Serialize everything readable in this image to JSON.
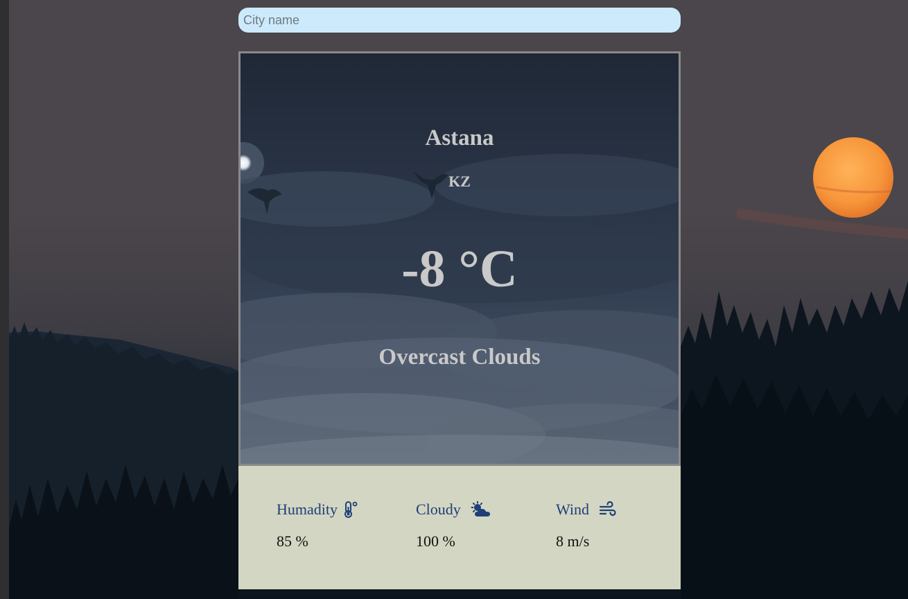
{
  "search": {
    "placeholder": "City name",
    "value": ""
  },
  "weather": {
    "city": "Astana",
    "country": "KZ",
    "temperature": "-8 °C",
    "description": "Overcast Clouds"
  },
  "details": [
    {
      "label": "Humadity",
      "value": "85 %",
      "icon": "thermometer-icon"
    },
    {
      "label": "Cloudy",
      "value": "100 %",
      "icon": "cloud-sun-icon"
    },
    {
      "label": "Wind",
      "value": "8 m/s",
      "icon": "wind-icon"
    }
  ],
  "colors": {
    "search_bg": "#cdeafc",
    "card_border": "#8a8a8a",
    "card_text": "#c9c9c9",
    "details_bg": "#d3d6c2",
    "details_label": "#1e3f78",
    "sun": "#f59a3c"
  }
}
